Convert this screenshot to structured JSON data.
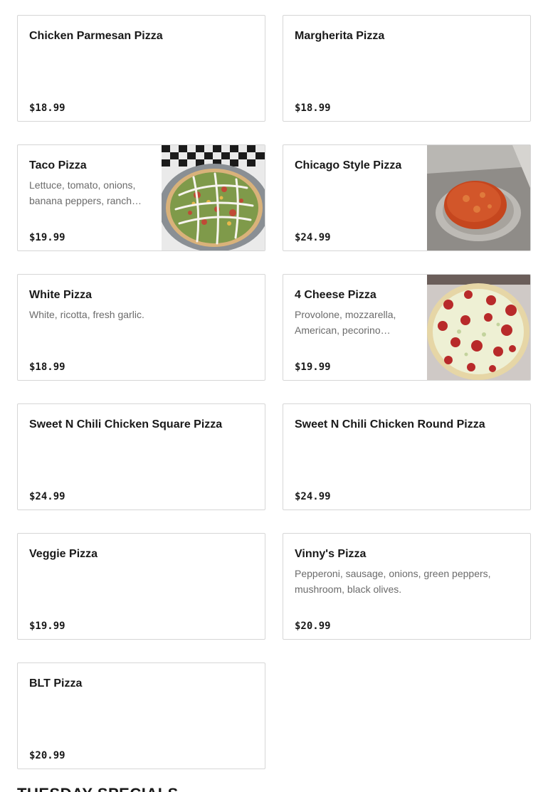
{
  "menu": {
    "items": [
      {
        "name": "Chicken Parmesan Pizza",
        "description": "",
        "price": "$18.99",
        "image": ""
      },
      {
        "name": "Margherita Pizza",
        "description": "",
        "price": "$18.99",
        "image": ""
      },
      {
        "name": "Taco Pizza",
        "description": "Lettuce, tomato, onions, banana peppers, ranch…",
        "price": "$19.99",
        "image": "taco-pizza-photo"
      },
      {
        "name": "Chicago Style Pizza",
        "description": "",
        "price": "$24.99",
        "image": "chicago-pizza-photo"
      },
      {
        "name": "White Pizza",
        "description": "White, ricotta, fresh garlic.",
        "price": "$18.99",
        "image": ""
      },
      {
        "name": "4 Cheese Pizza",
        "description": "Provolone, mozzarella, American, pecorino…",
        "price": "$19.99",
        "image": "four-cheese-pizza-photo"
      },
      {
        "name": "Sweet N Chili Chicken Square Pizza",
        "description": "",
        "price": "$24.99",
        "image": ""
      },
      {
        "name": "Sweet N Chili Chicken Round Pizza",
        "description": "",
        "price": "$24.99",
        "image": ""
      },
      {
        "name": "Veggie Pizza",
        "description": "",
        "price": "$19.99",
        "image": ""
      },
      {
        "name": "Vinny's Pizza",
        "description": "Pepperoni, sausage, onions, green peppers, mushroom, black olives.",
        "price": "$20.99",
        "image": ""
      },
      {
        "name": "BLT Pizza",
        "description": "",
        "price": "$20.99",
        "image": ""
      }
    ]
  },
  "next_section": {
    "title": "TUESDAY SPECIALS"
  }
}
